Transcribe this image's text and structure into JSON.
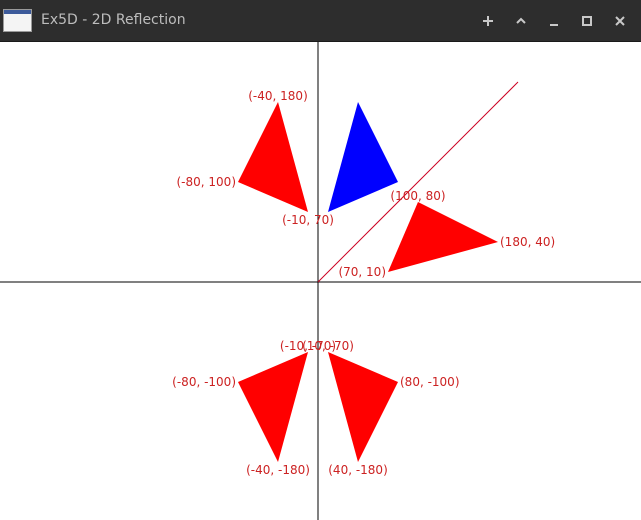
{
  "window": {
    "title": "Ex5D - 2D Reflection",
    "buttons": [
      {
        "name": "pin",
        "icon": "pin-icon"
      },
      {
        "name": "shade",
        "icon": "chevron-up-icon"
      },
      {
        "name": "minimize",
        "icon": "minimize-icon"
      },
      {
        "name": "maximize",
        "icon": "maximize-icon"
      },
      {
        "name": "close",
        "icon": "close-icon"
      }
    ]
  },
  "colors": {
    "axes": "#000000",
    "reflection_line": "#cc0022",
    "original": "#0000ff",
    "reflected": "#ff0000",
    "label_text": "#cc2222"
  },
  "scene": {
    "original_triangle": [
      [
        40,
        180
      ],
      [
        80,
        100
      ],
      [
        10,
        70
      ]
    ],
    "reflection_line": [
      [
        0,
        0
      ],
      [
        200,
        200
      ]
    ],
    "reflected_triangles": [
      {
        "name": "reflect-y-axis",
        "points": [
          [
            -40,
            180
          ],
          [
            -80,
            100
          ],
          [
            -10,
            70
          ]
        ],
        "labels": [
          "(-40, 180)",
          "(-80, 100)",
          "(-10, 70)"
        ]
      },
      {
        "name": "reflect-y-eq-x",
        "points": [
          [
            100,
            80
          ],
          [
            180,
            40
          ],
          [
            70,
            10
          ]
        ],
        "labels": [
          "(100, 80)",
          "(180, 40)",
          "(70, 10)"
        ]
      },
      {
        "name": "reflect-origin",
        "points": [
          [
            -10,
            -70
          ],
          [
            -80,
            -100
          ],
          [
            -40,
            -180
          ]
        ],
        "labels": [
          "(-10, -70)",
          "(-80, -100)",
          "(-40, -180)"
        ]
      },
      {
        "name": "reflect-x-axis",
        "points": [
          [
            10,
            -70
          ],
          [
            80,
            -100
          ],
          [
            40,
            -180
          ]
        ],
        "labels": [
          "(10, -70)",
          "(80, -100)",
          "(40, -180)"
        ]
      }
    ]
  }
}
